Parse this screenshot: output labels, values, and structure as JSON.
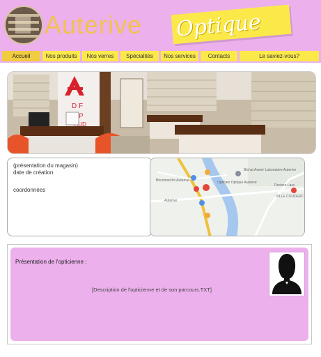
{
  "brand": {
    "name": "Auterive",
    "tagline": "Optique"
  },
  "nav": {
    "items": [
      {
        "label": "Accueil",
        "active": true
      },
      {
        "label": "Nos produits",
        "active": false
      },
      {
        "label": "Nos verres",
        "active": false
      },
      {
        "label": "Spécialités",
        "active": false
      },
      {
        "label": "Nos services",
        "active": false
      },
      {
        "label": "Contacts",
        "active": false
      },
      {
        "label": "Le saviez-vous?",
        "active": false
      }
    ]
  },
  "store_photo": {
    "sign_letter": "A",
    "sign_lines": [
      "D F",
      "ZP",
      "AUD"
    ]
  },
  "info": {
    "presentation": "(présentation du magasin)",
    "creation_date": "date de création",
    "coordinates": "coordonnées"
  },
  "map": {
    "labels": [
      "Bricomarché Auterive",
      "Opticien Optique Auterive",
      "Bichat Avenir Laboratoire Auterive",
      "Docteur Lara",
      "VILLE COUDERC",
      "Auterive"
    ]
  },
  "optician": {
    "heading": "Présentation de l'opticienne :",
    "description": "[Description de l'opticienne et de son parcours.TXT]"
  },
  "colors": {
    "header_pink": "#ecb0ec",
    "accent_yellow": "#fbe94a",
    "brand_text": "#f2c24d"
  }
}
